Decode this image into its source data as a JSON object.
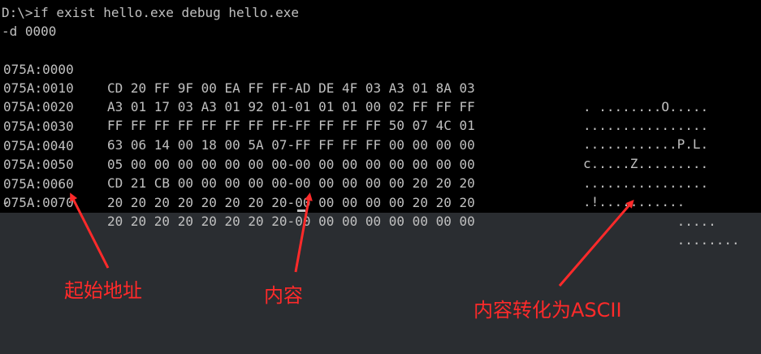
{
  "console": {
    "command": "D:\\>if exist hello.exe debug hello.exe",
    "debug_cmd": "-d 0000",
    "rows": [
      {
        "addr": "075A:0000",
        "hex": "CD 20 FF 9F 00 EA FF FF-AD DE 4F 03 A3 01 8A 03",
        "ascii": ". ........O....."
      },
      {
        "addr": "075A:0010",
        "hex": "A3 01 17 03 A3 01 92 01-01 01 01 00 02 FF FF FF",
        "ascii": "................"
      },
      {
        "addr": "075A:0020",
        "hex": "FF FF FF FF FF FF FF FF-FF FF FF FF 50 07 4C 01",
        "ascii": "............P.L."
      },
      {
        "addr": "075A:0030",
        "hex": "63 06 14 00 18 00 5A 07-FF FF FF FF 00 00 00 00",
        "ascii": "c.....Z........."
      },
      {
        "addr": "075A:0040",
        "hex": "05 00 00 00 00 00 00 00-00 00 00 00 00 00 00 00",
        "ascii": "................"
      },
      {
        "addr": "075A:0050",
        "hex": "CD 21 CB 00 00 00 00 00-00 00 00 00 00 20 20 20",
        "ascii": ".!..........."
      },
      {
        "addr": "075A:0060",
        "hex": "20 20 20 20 20 20 20 20-00 00 00 00 00 20 20 20",
        "ascii": "            ....."
      },
      {
        "addr": "075A:0070",
        "hex": "20 20 20 20 20 20 20 20-00 00 00 00 00 00 00 00",
        "ascii": "            ........"
      }
    ],
    "prompt": "-"
  },
  "annotations": {
    "start_address": "起始地址",
    "content": "内容",
    "content_ascii": "内容转化为ASCII"
  },
  "colors": {
    "console_bg": "#000000",
    "console_text": "#c0c0c0",
    "page_bg": "#2a2d31",
    "annotation": "#ff2a2a"
  }
}
